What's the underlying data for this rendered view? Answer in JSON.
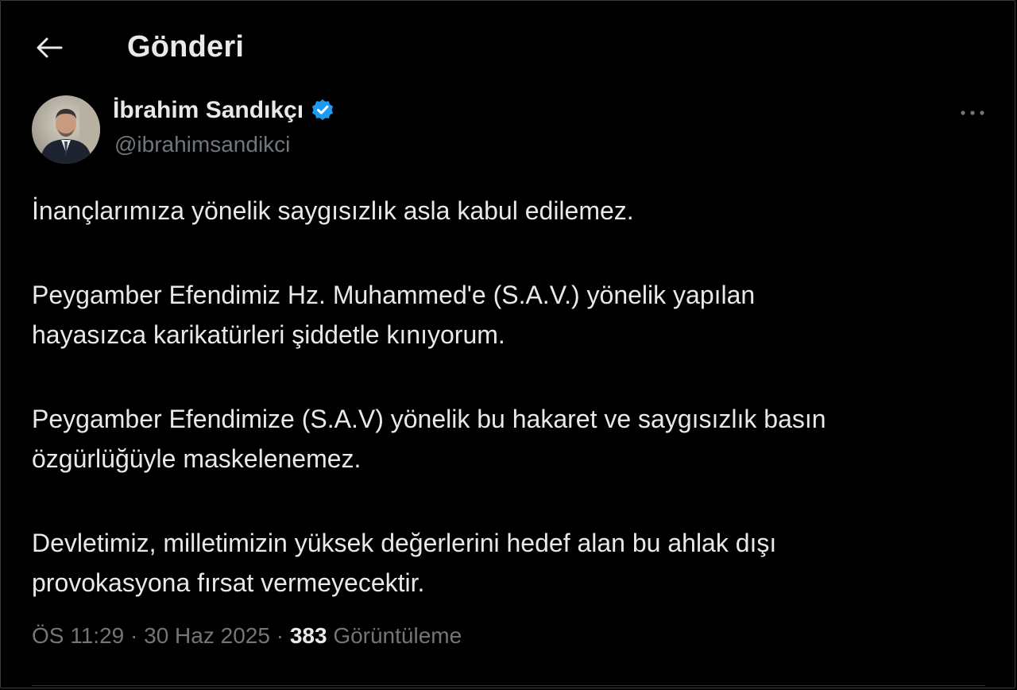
{
  "header": {
    "back_icon": "arrow-left-icon",
    "title": "Gönderi"
  },
  "author": {
    "name": "İbrahim Sandıkçı",
    "handle": "@ibrahimsandikci",
    "verified_icon": "verified-badge-icon",
    "verified_color": "#1d9bf0"
  },
  "more_icon": "more-horizontal-icon",
  "post": {
    "paragraphs": [
      "İnançlarımıza yönelik saygısızlık asla kabul edilemez.",
      "Peygamber Efendimiz Hz. Muhammed'e (S.A.V.) yönelik yapılan hayasızca karikatürleri şiddetle kınıyorum.",
      "Peygamber Efendimize (S.A.V) yönelik bu hakaret ve saygısızlık basın özgürlüğüyle maskelenemez.",
      "Devletimiz, milletimizin yüksek değerlerini hedef alan bu ahlak dışı provokasyona fırsat vermeyecektir."
    ],
    "time": "ÖS 11:29",
    "separator": "·",
    "date": "30 Haz 2025",
    "views_count": "383",
    "views_label": "Görüntüleme"
  }
}
